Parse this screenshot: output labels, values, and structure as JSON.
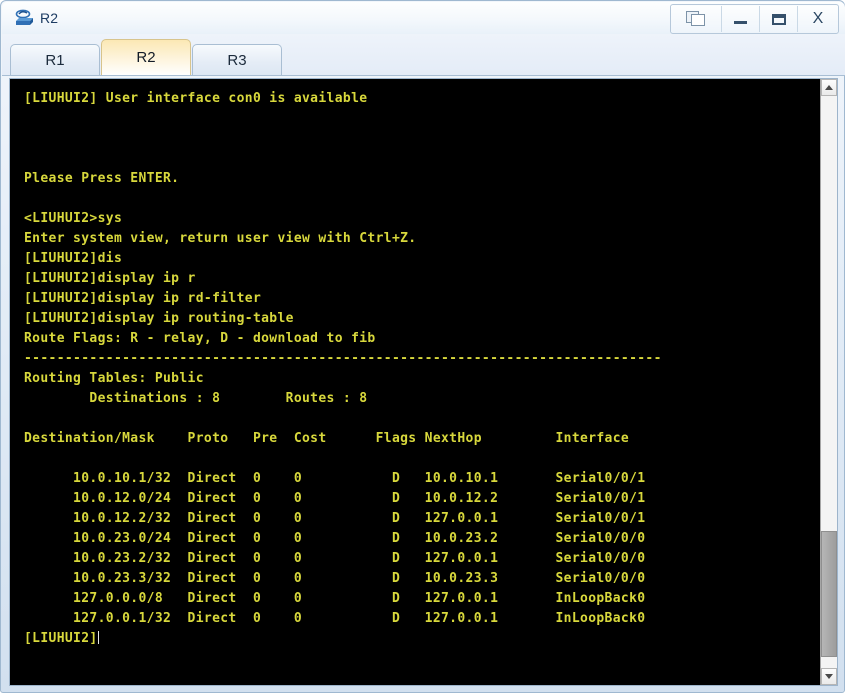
{
  "window": {
    "title": "R2",
    "icon": "router-icon",
    "controls": {
      "cascade_label": "",
      "minimize_label": "",
      "maximize_label": "",
      "close_label": "X"
    }
  },
  "tabs": [
    {
      "label": "R1",
      "active": false
    },
    {
      "label": "R2",
      "active": true
    },
    {
      "label": "R3",
      "active": false
    }
  ],
  "terminal": {
    "fg_color": "#d8d83c",
    "bg_color": "#000000",
    "prompt": "[LIUHUI2]",
    "lines": [
      "[LIUHUI2] User interface con0 is available",
      "",
      "",
      "",
      "Please Press ENTER.",
      "",
      "<LIUHUI2>sys",
      "Enter system view, return user view with Ctrl+Z.",
      "[LIUHUI2]dis",
      "[LIUHUI2]display ip r",
      "[LIUHUI2]display ip rd-filter",
      "[LIUHUI2]display ip routing-table",
      "Route Flags: R - relay, D - download to fib",
      "------------------------------------------------------------------------------",
      "Routing Tables: Public",
      "        Destinations : 8        Routes : 8",
      "",
      "Destination/Mask    Proto   Pre  Cost      Flags NextHop         Interface",
      "",
      "      10.0.10.1/32  Direct  0    0           D   10.0.10.1       Serial0/0/1",
      "      10.0.12.0/24  Direct  0    0           D   10.0.12.2       Serial0/0/1",
      "      10.0.12.2/32  Direct  0    0           D   127.0.0.1       Serial0/0/1",
      "      10.0.23.0/24  Direct  0    0           D   10.0.23.2       Serial0/0/0",
      "      10.0.23.2/32  Direct  0    0           D   127.0.0.1       Serial0/0/0",
      "      10.0.23.3/32  Direct  0    0           D   10.0.23.3       Serial0/0/0",
      "      127.0.0.0/8   Direct  0    0           D   127.0.0.1       InLoopBack0",
      "      127.0.0.1/32  Direct  0    0           D   127.0.0.1       InLoopBack0",
      ""
    ],
    "routing_table": {
      "headers": [
        "Destination/Mask",
        "Proto",
        "Pre",
        "Cost",
        "Flags",
        "NextHop",
        "Interface"
      ],
      "rows": [
        [
          "10.0.10.1/32",
          "Direct",
          "0",
          "0",
          "D",
          "10.0.10.1",
          "Serial0/0/1"
        ],
        [
          "10.0.12.0/24",
          "Direct",
          "0",
          "0",
          "D",
          "10.0.12.2",
          "Serial0/0/1"
        ],
        [
          "10.0.12.2/32",
          "Direct",
          "0",
          "0",
          "D",
          "127.0.0.1",
          "Serial0/0/1"
        ],
        [
          "10.0.23.0/24",
          "Direct",
          "0",
          "0",
          "D",
          "10.0.23.2",
          "Serial0/0/0"
        ],
        [
          "10.0.23.2/32",
          "Direct",
          "0",
          "0",
          "D",
          "127.0.0.1",
          "Serial0/0/0"
        ],
        [
          "10.0.23.3/32",
          "Direct",
          "0",
          "0",
          "D",
          "10.0.23.3",
          "Serial0/0/0"
        ],
        [
          "127.0.0.0/8",
          "Direct",
          "0",
          "0",
          "D",
          "127.0.0.1",
          "InLoopBack0"
        ],
        [
          "127.0.0.1/32",
          "Direct",
          "0",
          "0",
          "D",
          "127.0.0.1",
          "InLoopBack0"
        ]
      ],
      "destinations": "8",
      "routes": "8",
      "table_name": "Public",
      "route_flags": "Route Flags: R - relay, D - download to fib"
    }
  },
  "scrollbar": {
    "up_arrow": "chevron-up-icon",
    "down_arrow": "chevron-down-icon",
    "thumb_top_pct": 76,
    "thumb_height_pct": 22
  }
}
